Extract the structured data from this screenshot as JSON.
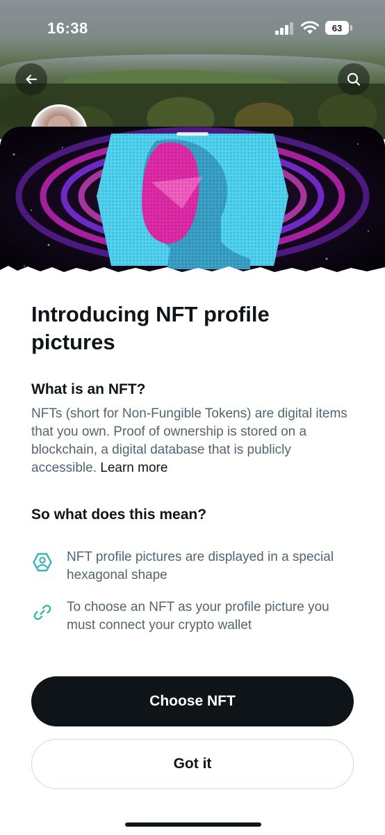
{
  "status_bar": {
    "time": "16:38",
    "battery": "63",
    "icons": [
      "cellular-signal-icon",
      "wifi-icon",
      "battery-icon"
    ]
  },
  "profile_header": {
    "back_icon": "arrow-left-icon",
    "search_icon": "search-icon"
  },
  "sheet": {
    "title": "Introducing NFT profile pictures",
    "what_heading": "What is an NFT?",
    "what_body": "NFTs (short for Non-Fungible Tokens) are digital items that you own. Proof of ownership is stored on a blockchain, a digital database that is publicly accessible.",
    "learn_more": "Learn more",
    "mean_heading": "So what does this mean?",
    "features": [
      {
        "icon": "hexagon-profile-icon",
        "text": "NFT profile pictures are displayed in a special hexagonal shape"
      },
      {
        "icon": "link-icon",
        "text": "To choose an NFT as your profile picture you must connect your crypto wallet"
      }
    ],
    "primary_button": "Choose NFT",
    "secondary_button": "Got it"
  },
  "colors": {
    "text_primary": "#0f1419",
    "text_secondary": "#536471",
    "accent_teal": "#3bb3b8",
    "button_dark": "#0f1419",
    "hero_cyan": "#4fd3f0",
    "hero_magenta": "#e02ba8",
    "hero_purple": "#7a2bd8"
  }
}
